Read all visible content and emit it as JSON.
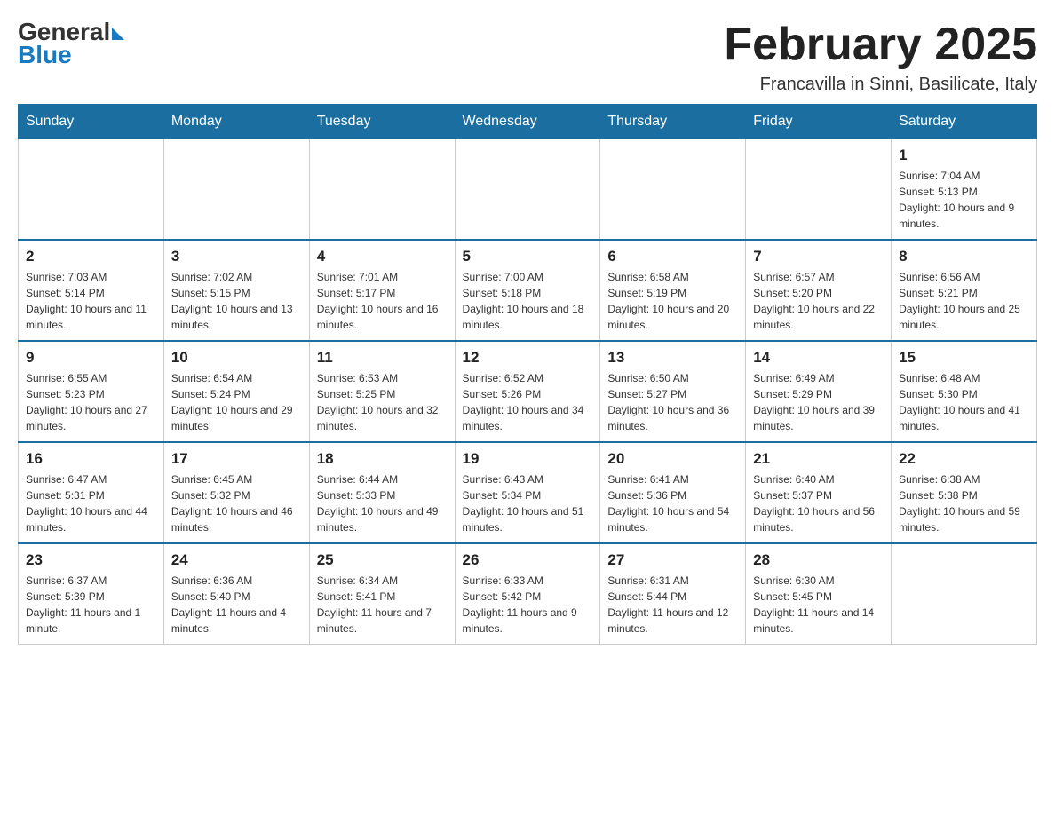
{
  "header": {
    "logo_general": "General",
    "logo_blue": "Blue",
    "month_title": "February 2025",
    "location": "Francavilla in Sinni, Basilicate, Italy"
  },
  "weekdays": [
    "Sunday",
    "Monday",
    "Tuesday",
    "Wednesday",
    "Thursday",
    "Friday",
    "Saturday"
  ],
  "weeks": [
    [
      {
        "day": "",
        "info": ""
      },
      {
        "day": "",
        "info": ""
      },
      {
        "day": "",
        "info": ""
      },
      {
        "day": "",
        "info": ""
      },
      {
        "day": "",
        "info": ""
      },
      {
        "day": "",
        "info": ""
      },
      {
        "day": "1",
        "info": "Sunrise: 7:04 AM\nSunset: 5:13 PM\nDaylight: 10 hours and 9 minutes."
      }
    ],
    [
      {
        "day": "2",
        "info": "Sunrise: 7:03 AM\nSunset: 5:14 PM\nDaylight: 10 hours and 11 minutes."
      },
      {
        "day": "3",
        "info": "Sunrise: 7:02 AM\nSunset: 5:15 PM\nDaylight: 10 hours and 13 minutes."
      },
      {
        "day": "4",
        "info": "Sunrise: 7:01 AM\nSunset: 5:17 PM\nDaylight: 10 hours and 16 minutes."
      },
      {
        "day": "5",
        "info": "Sunrise: 7:00 AM\nSunset: 5:18 PM\nDaylight: 10 hours and 18 minutes."
      },
      {
        "day": "6",
        "info": "Sunrise: 6:58 AM\nSunset: 5:19 PM\nDaylight: 10 hours and 20 minutes."
      },
      {
        "day": "7",
        "info": "Sunrise: 6:57 AM\nSunset: 5:20 PM\nDaylight: 10 hours and 22 minutes."
      },
      {
        "day": "8",
        "info": "Sunrise: 6:56 AM\nSunset: 5:21 PM\nDaylight: 10 hours and 25 minutes."
      }
    ],
    [
      {
        "day": "9",
        "info": "Sunrise: 6:55 AM\nSunset: 5:23 PM\nDaylight: 10 hours and 27 minutes."
      },
      {
        "day": "10",
        "info": "Sunrise: 6:54 AM\nSunset: 5:24 PM\nDaylight: 10 hours and 29 minutes."
      },
      {
        "day": "11",
        "info": "Sunrise: 6:53 AM\nSunset: 5:25 PM\nDaylight: 10 hours and 32 minutes."
      },
      {
        "day": "12",
        "info": "Sunrise: 6:52 AM\nSunset: 5:26 PM\nDaylight: 10 hours and 34 minutes."
      },
      {
        "day": "13",
        "info": "Sunrise: 6:50 AM\nSunset: 5:27 PM\nDaylight: 10 hours and 36 minutes."
      },
      {
        "day": "14",
        "info": "Sunrise: 6:49 AM\nSunset: 5:29 PM\nDaylight: 10 hours and 39 minutes."
      },
      {
        "day": "15",
        "info": "Sunrise: 6:48 AM\nSunset: 5:30 PM\nDaylight: 10 hours and 41 minutes."
      }
    ],
    [
      {
        "day": "16",
        "info": "Sunrise: 6:47 AM\nSunset: 5:31 PM\nDaylight: 10 hours and 44 minutes."
      },
      {
        "day": "17",
        "info": "Sunrise: 6:45 AM\nSunset: 5:32 PM\nDaylight: 10 hours and 46 minutes."
      },
      {
        "day": "18",
        "info": "Sunrise: 6:44 AM\nSunset: 5:33 PM\nDaylight: 10 hours and 49 minutes."
      },
      {
        "day": "19",
        "info": "Sunrise: 6:43 AM\nSunset: 5:34 PM\nDaylight: 10 hours and 51 minutes."
      },
      {
        "day": "20",
        "info": "Sunrise: 6:41 AM\nSunset: 5:36 PM\nDaylight: 10 hours and 54 minutes."
      },
      {
        "day": "21",
        "info": "Sunrise: 6:40 AM\nSunset: 5:37 PM\nDaylight: 10 hours and 56 minutes."
      },
      {
        "day": "22",
        "info": "Sunrise: 6:38 AM\nSunset: 5:38 PM\nDaylight: 10 hours and 59 minutes."
      }
    ],
    [
      {
        "day": "23",
        "info": "Sunrise: 6:37 AM\nSunset: 5:39 PM\nDaylight: 11 hours and 1 minute."
      },
      {
        "day": "24",
        "info": "Sunrise: 6:36 AM\nSunset: 5:40 PM\nDaylight: 11 hours and 4 minutes."
      },
      {
        "day": "25",
        "info": "Sunrise: 6:34 AM\nSunset: 5:41 PM\nDaylight: 11 hours and 7 minutes."
      },
      {
        "day": "26",
        "info": "Sunrise: 6:33 AM\nSunset: 5:42 PM\nDaylight: 11 hours and 9 minutes."
      },
      {
        "day": "27",
        "info": "Sunrise: 6:31 AM\nSunset: 5:44 PM\nDaylight: 11 hours and 12 minutes."
      },
      {
        "day": "28",
        "info": "Sunrise: 6:30 AM\nSunset: 5:45 PM\nDaylight: 11 hours and 14 minutes."
      },
      {
        "day": "",
        "info": ""
      }
    ]
  ]
}
